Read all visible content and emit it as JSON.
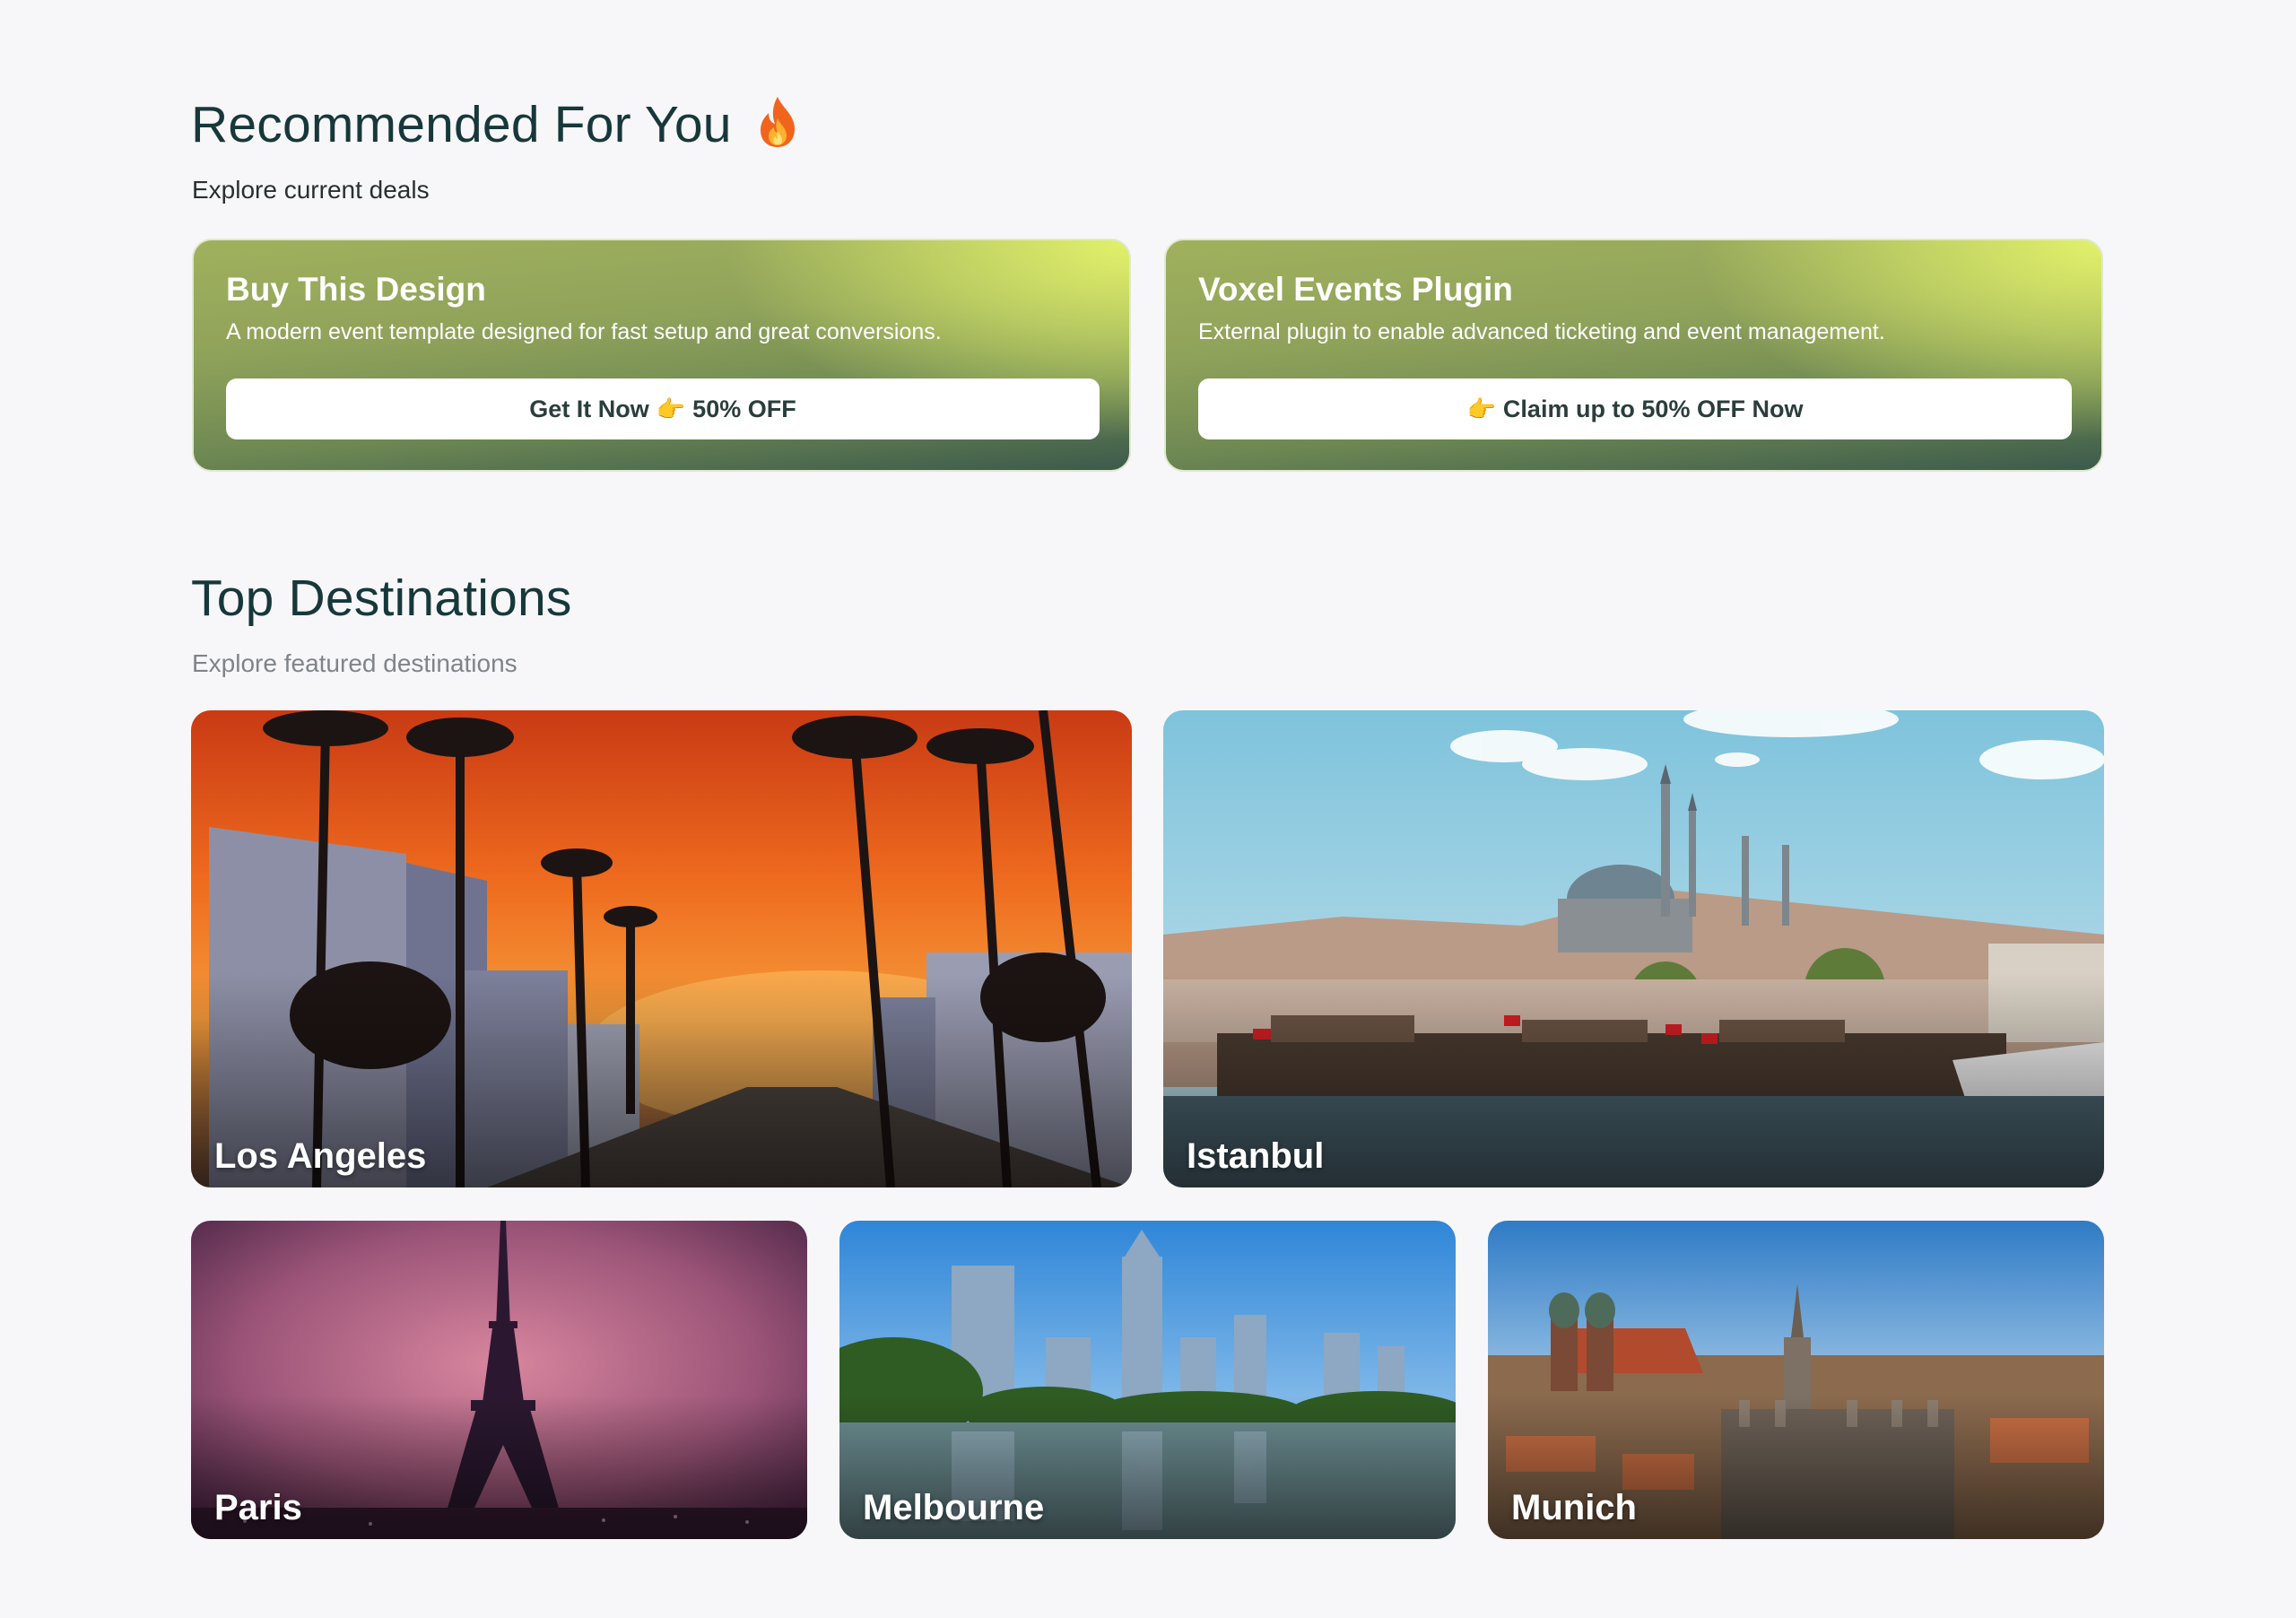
{
  "recommended": {
    "title": "Recommended For You",
    "title_icon": "fire-icon",
    "subtitle": "Explore current deals",
    "deals": [
      {
        "title": "Buy This Design",
        "description": "A modern event template designed for fast setup and great conversions.",
        "button_text_before": "Get It Now",
        "button_icon": "pointing-hand-icon",
        "button_text_after": "50% OFF"
      },
      {
        "title": "Voxel Events Plugin",
        "description": "External plugin to enable advanced ticketing and event management.",
        "button_text_before": "",
        "button_icon": "pointing-hand-icon",
        "button_text_after": "Claim up to 50% OFF Now"
      }
    ]
  },
  "destinations": {
    "title": "Top Destinations",
    "subtitle": "Explore featured destinations",
    "items": [
      {
        "name": "Los Angeles"
      },
      {
        "name": "Istanbul"
      },
      {
        "name": "Paris"
      },
      {
        "name": "Melbourne"
      },
      {
        "name": "Munich"
      }
    ]
  },
  "colors": {
    "heading": "#17383a",
    "deal_gradient_light": "#e2f16a",
    "deal_gradient_dark": "#3b5a4c",
    "button_bg": "#ffffff",
    "button_text": "#2a3e3b"
  }
}
